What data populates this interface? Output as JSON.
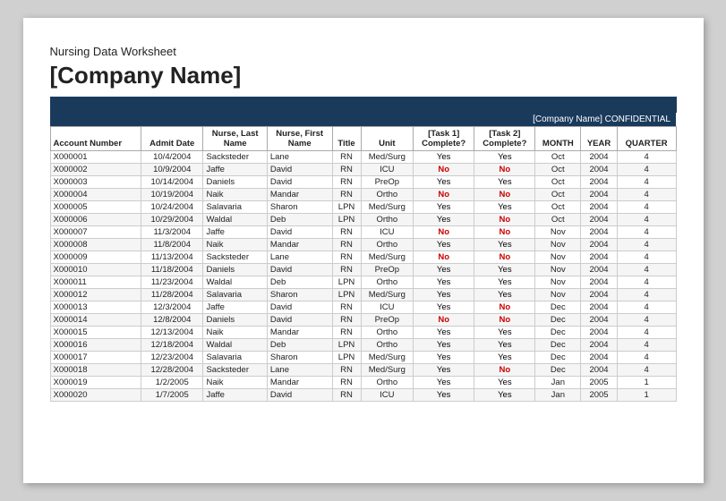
{
  "header": {
    "worksheet_title": "Nursing Data Worksheet",
    "company_name": "[Company Name]",
    "confidential_text": "[Company Name] CONFIDENTIAL"
  },
  "columns": [
    {
      "key": "account_number",
      "label": "Account Number",
      "line2": ""
    },
    {
      "key": "admit_date",
      "label": "Admit Date",
      "line2": ""
    },
    {
      "key": "nurse_last",
      "label": "Nurse, Last",
      "line2": "Name"
    },
    {
      "key": "nurse_first",
      "label": "Nurse, First",
      "line2": "Name"
    },
    {
      "key": "title",
      "label": "Title",
      "line2": ""
    },
    {
      "key": "unit",
      "label": "Unit",
      "line2": ""
    },
    {
      "key": "task1",
      "label": "[Task 1]",
      "line2": "Complete?"
    },
    {
      "key": "task2",
      "label": "[Task 2]",
      "line2": "Complete?"
    },
    {
      "key": "month",
      "label": "MONTH",
      "line2": ""
    },
    {
      "key": "year",
      "label": "YEAR",
      "line2": ""
    },
    {
      "key": "quarter",
      "label": "QUARTER",
      "line2": ""
    }
  ],
  "rows": [
    {
      "account_number": "X000001",
      "admit_date": "10/4/2004",
      "nurse_last": "Sacksteder",
      "nurse_first": "Lane",
      "title": "RN",
      "unit": "Med/Surg",
      "task1": "Yes",
      "task2": "Yes",
      "month": "Oct",
      "year": "2004",
      "quarter": "4"
    },
    {
      "account_number": "X000002",
      "admit_date": "10/9/2004",
      "nurse_last": "Jaffe",
      "nurse_first": "David",
      "title": "RN",
      "unit": "ICU",
      "task1": "No",
      "task2": "No",
      "month": "Oct",
      "year": "2004",
      "quarter": "4"
    },
    {
      "account_number": "X000003",
      "admit_date": "10/14/2004",
      "nurse_last": "Daniels",
      "nurse_first": "David",
      "title": "RN",
      "unit": "PreOp",
      "task1": "Yes",
      "task2": "Yes",
      "month": "Oct",
      "year": "2004",
      "quarter": "4"
    },
    {
      "account_number": "X000004",
      "admit_date": "10/19/2004",
      "nurse_last": "Naik",
      "nurse_first": "Mandar",
      "title": "RN",
      "unit": "Ortho",
      "task1": "No",
      "task2": "No",
      "month": "Oct",
      "year": "2004",
      "quarter": "4"
    },
    {
      "account_number": "X000005",
      "admit_date": "10/24/2004",
      "nurse_last": "Salavaria",
      "nurse_first": "Sharon",
      "title": "LPN",
      "unit": "Med/Surg",
      "task1": "Yes",
      "task2": "Yes",
      "month": "Oct",
      "year": "2004",
      "quarter": "4"
    },
    {
      "account_number": "X000006",
      "admit_date": "10/29/2004",
      "nurse_last": "Waldal",
      "nurse_first": "Deb",
      "title": "LPN",
      "unit": "Ortho",
      "task1": "Yes",
      "task2": "No",
      "month": "Oct",
      "year": "2004",
      "quarter": "4"
    },
    {
      "account_number": "X000007",
      "admit_date": "11/3/2004",
      "nurse_last": "Jaffe",
      "nurse_first": "David",
      "title": "RN",
      "unit": "ICU",
      "task1": "No",
      "task2": "No",
      "month": "Nov",
      "year": "2004",
      "quarter": "4"
    },
    {
      "account_number": "X000008",
      "admit_date": "11/8/2004",
      "nurse_last": "Naik",
      "nurse_first": "Mandar",
      "title": "RN",
      "unit": "Ortho",
      "task1": "Yes",
      "task2": "Yes",
      "month": "Nov",
      "year": "2004",
      "quarter": "4"
    },
    {
      "account_number": "X000009",
      "admit_date": "11/13/2004",
      "nurse_last": "Sacksteder",
      "nurse_first": "Lane",
      "title": "RN",
      "unit": "Med/Surg",
      "task1": "No",
      "task2": "No",
      "month": "Nov",
      "year": "2004",
      "quarter": "4"
    },
    {
      "account_number": "X000010",
      "admit_date": "11/18/2004",
      "nurse_last": "Daniels",
      "nurse_first": "David",
      "title": "RN",
      "unit": "PreOp",
      "task1": "Yes",
      "task2": "Yes",
      "month": "Nov",
      "year": "2004",
      "quarter": "4"
    },
    {
      "account_number": "X000011",
      "admit_date": "11/23/2004",
      "nurse_last": "Waldal",
      "nurse_first": "Deb",
      "title": "LPN",
      "unit": "Ortho",
      "task1": "Yes",
      "task2": "Yes",
      "month": "Nov",
      "year": "2004",
      "quarter": "4"
    },
    {
      "account_number": "X000012",
      "admit_date": "11/28/2004",
      "nurse_last": "Salavaria",
      "nurse_first": "Sharon",
      "title": "LPN",
      "unit": "Med/Surg",
      "task1": "Yes",
      "task2": "Yes",
      "month": "Nov",
      "year": "2004",
      "quarter": "4"
    },
    {
      "account_number": "X000013",
      "admit_date": "12/3/2004",
      "nurse_last": "Jaffe",
      "nurse_first": "David",
      "title": "RN",
      "unit": "ICU",
      "task1": "Yes",
      "task2": "No",
      "month": "Dec",
      "year": "2004",
      "quarter": "4"
    },
    {
      "account_number": "X000014",
      "admit_date": "12/8/2004",
      "nurse_last": "Daniels",
      "nurse_first": "David",
      "title": "RN",
      "unit": "PreOp",
      "task1": "No",
      "task2": "No",
      "month": "Dec",
      "year": "2004",
      "quarter": "4"
    },
    {
      "account_number": "X000015",
      "admit_date": "12/13/2004",
      "nurse_last": "Naik",
      "nurse_first": "Mandar",
      "title": "RN",
      "unit": "Ortho",
      "task1": "Yes",
      "task2": "Yes",
      "month": "Dec",
      "year": "2004",
      "quarter": "4"
    },
    {
      "account_number": "X000016",
      "admit_date": "12/18/2004",
      "nurse_last": "Waldal",
      "nurse_first": "Deb",
      "title": "LPN",
      "unit": "Ortho",
      "task1": "Yes",
      "task2": "Yes",
      "month": "Dec",
      "year": "2004",
      "quarter": "4"
    },
    {
      "account_number": "X000017",
      "admit_date": "12/23/2004",
      "nurse_last": "Salavaria",
      "nurse_first": "Sharon",
      "title": "LPN",
      "unit": "Med/Surg",
      "task1": "Yes",
      "task2": "Yes",
      "month": "Dec",
      "year": "2004",
      "quarter": "4"
    },
    {
      "account_number": "X000018",
      "admit_date": "12/28/2004",
      "nurse_last": "Sacksteder",
      "nurse_first": "Lane",
      "title": "RN",
      "unit": "Med/Surg",
      "task1": "Yes",
      "task2": "No",
      "month": "Dec",
      "year": "2004",
      "quarter": "4"
    },
    {
      "account_number": "X000019",
      "admit_date": "1/2/2005",
      "nurse_last": "Naik",
      "nurse_first": "Mandar",
      "title": "RN",
      "unit": "Ortho",
      "task1": "Yes",
      "task2": "Yes",
      "month": "Jan",
      "year": "2005",
      "quarter": "1"
    },
    {
      "account_number": "X000020",
      "admit_date": "1/7/2005",
      "nurse_last": "Jaffe",
      "nurse_first": "David",
      "title": "RN",
      "unit": "ICU",
      "task1": "Yes",
      "task2": "Yes",
      "month": "Jan",
      "year": "2005",
      "quarter": "1"
    }
  ]
}
